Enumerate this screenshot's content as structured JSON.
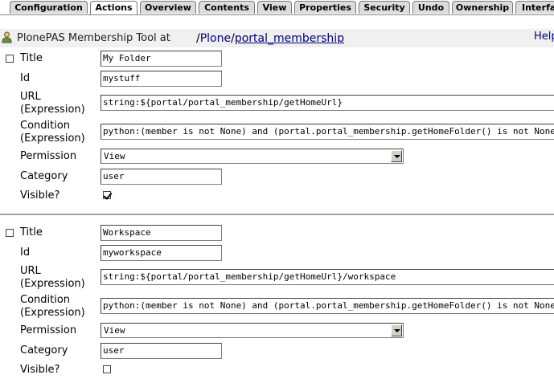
{
  "tabs": [
    {
      "label": "Configuration",
      "active": false
    },
    {
      "label": "Actions",
      "active": true
    },
    {
      "label": "Overview",
      "active": false
    },
    {
      "label": "Contents",
      "active": false
    },
    {
      "label": "View",
      "active": false
    },
    {
      "label": "Properties",
      "active": false
    },
    {
      "label": "Security",
      "active": false
    },
    {
      "label": "Undo",
      "active": false
    },
    {
      "label": "Ownership",
      "active": false
    },
    {
      "label": "Interfa",
      "active": false
    }
  ],
  "header": {
    "icon": "person-icon",
    "title": "PlonePAS Membership Tool at",
    "path_sep1": "/",
    "path_part1": "Plone",
    "path_sep2": "/",
    "path_part2": "portal_membership",
    "help": "Help"
  },
  "labels": {
    "title": "Title",
    "id": "Id",
    "url_line1": "URL",
    "url_line2": "(Expression)",
    "condition_line1": "Condition",
    "condition_line2": "(Expression)",
    "permission": "Permission",
    "category": "Category",
    "visible": "Visible?"
  },
  "actions": [
    {
      "selected": false,
      "title": "My Folder",
      "id": "mystuff",
      "url": "string:${portal/portal_membership/getHomeUrl}",
      "condition": "python:(member is not None) and (portal.portal_membership.getHomeFolder() is not None)",
      "permission": "View",
      "category": "user",
      "visible": true
    },
    {
      "selected": false,
      "title": "Workspace",
      "id": "myworkspace",
      "url": "string:${portal/portal_membership/getHomeUrl}/workspace",
      "condition": "python:(member is not None) and (portal.portal_membership.getHomeFolder() is not None)",
      "permission": "View",
      "category": "user",
      "visible": false
    }
  ],
  "colors": {
    "link": "#000080",
    "header_bg": "#f0f0f0",
    "tab_bg": "#dcdcdc"
  }
}
